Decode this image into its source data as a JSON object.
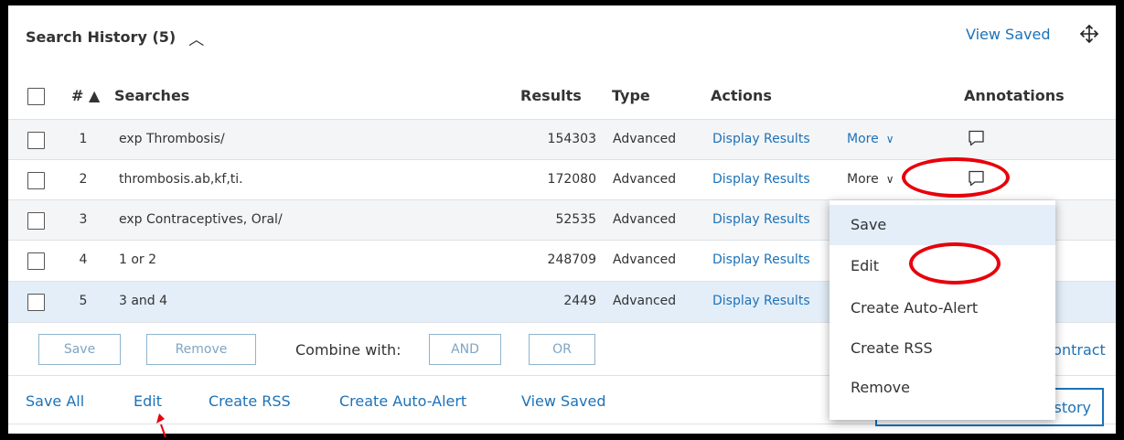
{
  "header": {
    "title": "Search History (5)",
    "collapse_icon": "chevron-up-icon",
    "view_saved": "View Saved",
    "move_icon": "move-icon"
  },
  "columns": {
    "number": "#",
    "sort_icon": "▲",
    "searches": "Searches",
    "results": "Results",
    "type": "Type",
    "actions": "Actions",
    "annotations": "Annotations"
  },
  "rows": [
    {
      "num": "1",
      "search": "exp Thrombosis/",
      "results": "154303",
      "type": "Advanced",
      "display": "Display Results",
      "more": "More"
    },
    {
      "num": "2",
      "search": "thrombosis.ab,kf,ti.",
      "results": "172080",
      "type": "Advanced",
      "display": "Display Results",
      "more": "More"
    },
    {
      "num": "3",
      "search": "exp Contraceptives, Oral/",
      "results": "52535",
      "type": "Advanced",
      "display": "Display Results"
    },
    {
      "num": "4",
      "search": "1 or 2",
      "results": "248709",
      "type": "Advanced",
      "display": "Display Results"
    },
    {
      "num": "5",
      "search": "3 and 4",
      "results": "2449",
      "type": "Advanced",
      "display": "Display Results"
    }
  ],
  "buttons": {
    "save": "Save",
    "remove": "Remove",
    "combine_with": "Combine with:",
    "and": "AND",
    "or": "OR",
    "contract": "Contract"
  },
  "actions_bar": {
    "save_all": "Save All",
    "edit": "Edit",
    "create_rss": "Create RSS",
    "create_auto_alert": "Create Auto-Alert",
    "view_saved": "View Saved",
    "clear_history": "story"
  },
  "more_menu": {
    "items": [
      "Save",
      "Edit",
      "Create Auto-Alert",
      "Create RSS",
      "Remove"
    ]
  },
  "annotation_colors": {
    "highlight": "#e8000b",
    "link": "#1d72b8"
  }
}
